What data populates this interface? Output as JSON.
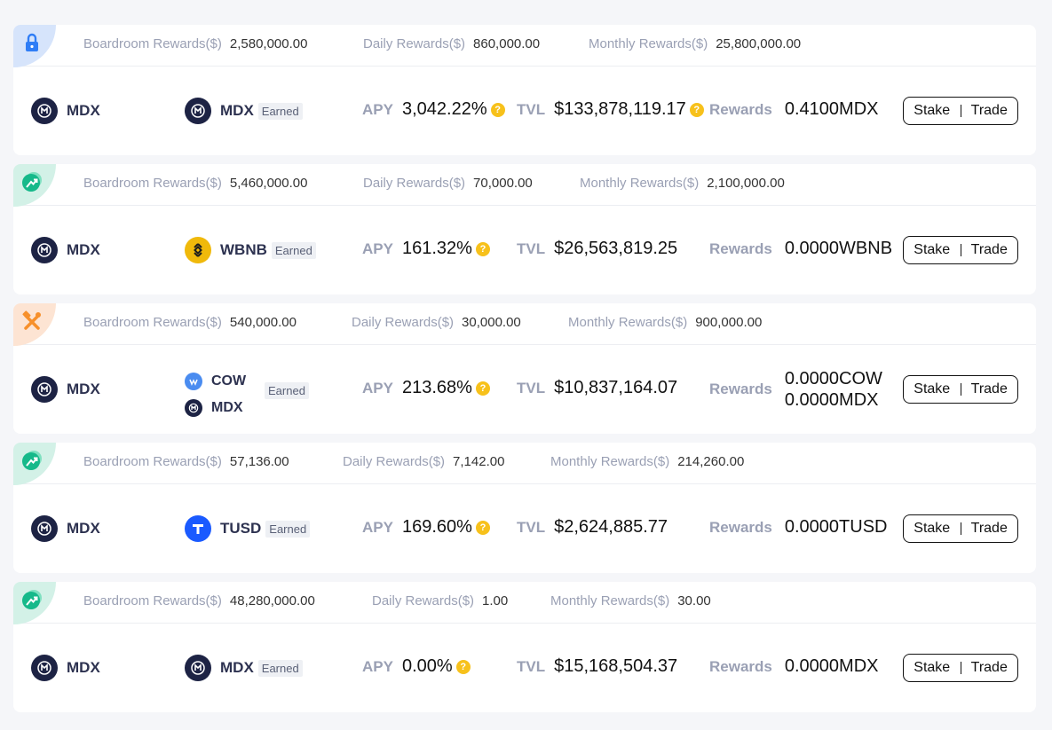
{
  "labels": {
    "boardroom": "Boardroom Rewards($)",
    "daily": "Daily Rewards($)",
    "monthly": "Monthly Rewards($)",
    "apy": "APY",
    "tvl": "TVL",
    "rewards": "Rewards",
    "earned": "Earned",
    "stake": "Stake",
    "trade": "Trade",
    "help": "?"
  },
  "pools": [
    {
      "corner_icon": "lock-icon",
      "boardroom": "2,580,000.00",
      "daily": "860,000.00",
      "monthly": "25,800,000.00",
      "stake_token": "MDX",
      "earn_token": "MDX",
      "apy": "3,042.22%",
      "tvl": "$133,878,119.17",
      "rewards": "0.4100MDX"
    },
    {
      "corner_icon": "trend-up-icon",
      "boardroom": "5,460,000.00",
      "daily": "70,000.00",
      "monthly": "2,100,000.00",
      "stake_token": "MDX",
      "earn_token": "WBNB",
      "apy": "161.32%",
      "tvl": "$26,563,819.25",
      "rewards": "0.0000WBNB"
    },
    {
      "corner_icon": "tools-icon",
      "boardroom": "540,000.00",
      "daily": "30,000.00",
      "monthly": "900,000.00",
      "stake_token": "MDX",
      "earn_tokens": [
        "COW",
        "MDX"
      ],
      "apy": "213.68%",
      "tvl": "$10,837,164.07",
      "rewards_list": [
        "0.0000COW",
        "0.0000MDX"
      ]
    },
    {
      "corner_icon": "trend-up-icon",
      "boardroom": "57,136.00",
      "daily": "7,142.00",
      "monthly": "214,260.00",
      "stake_token": "MDX",
      "earn_token": "TUSD",
      "apy": "169.60%",
      "tvl": "$2,624,885.77",
      "rewards": "0.0000TUSD"
    },
    {
      "corner_icon": "trend-up-icon",
      "boardroom": "48,280,000.00",
      "daily": "1.00",
      "monthly": "30.00",
      "stake_token": "MDX",
      "earn_token": "MDX",
      "apy": "0.00%",
      "tvl": "$15,168,504.37",
      "rewards": "0.0000MDX"
    }
  ],
  "colors": {
    "lock_bg": "#d6e4fb",
    "trend_bg": "#d3f1e7",
    "tool_bg": "#fde4d3",
    "help_icon": "#f7c11b",
    "mdx_logo": "#1d2344",
    "bnb_logo": "#f0b90b",
    "tusd_logo": "#1a5aff"
  }
}
